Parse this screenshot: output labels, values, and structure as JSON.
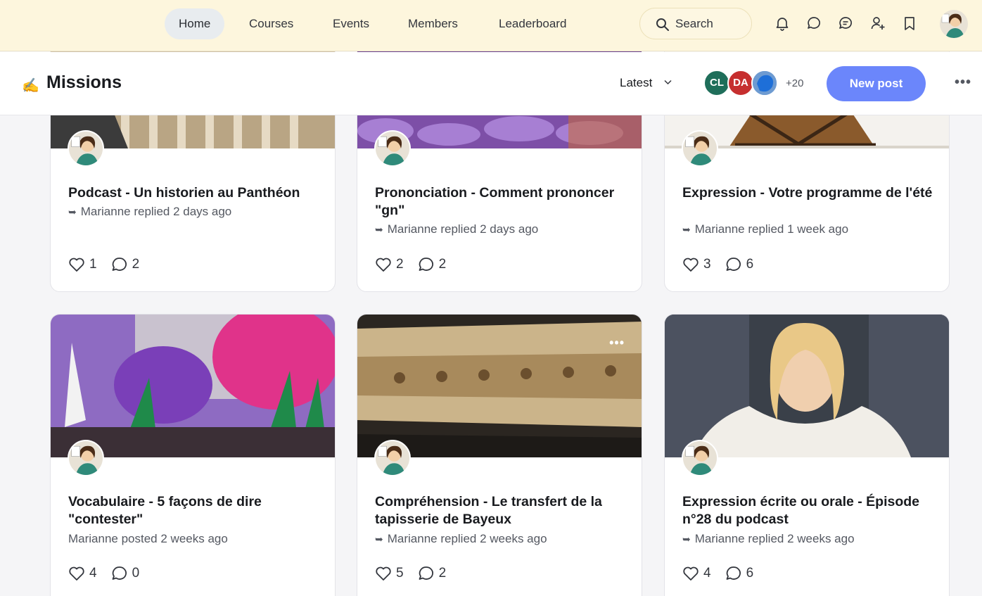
{
  "nav": {
    "items": [
      {
        "label": "Home",
        "active": true
      },
      {
        "label": "Courses"
      },
      {
        "label": "Events"
      },
      {
        "label": "Members"
      },
      {
        "label": "Leaderboard"
      }
    ],
    "search_label": "Search",
    "icons": [
      "bell-icon",
      "chat-icon",
      "messages-icon",
      "add-user-icon",
      "bookmark-icon"
    ]
  },
  "space": {
    "emoji": "✍️",
    "title": "Missions",
    "sort_label": "Latest",
    "members": [
      {
        "initials": "CL",
        "color": "#1f6e5a"
      },
      {
        "initials": "DA",
        "color": "#c62f2f"
      },
      {
        "initials": "",
        "color": "#3b82d6"
      }
    ],
    "member_extra": "+20",
    "new_post_label": "New post",
    "more_label": "•••"
  },
  "posts": [
    {
      "title": "Podcast - Un historien au Panthéon",
      "meta": "Marianne replied 2 days ago",
      "replied": true,
      "likes": "1",
      "comments": "2"
    },
    {
      "title": "Prononciation - Comment prononcer \"gn\"",
      "meta": "Marianne replied 2 days ago",
      "replied": true,
      "likes": "2",
      "comments": "2"
    },
    {
      "title": "Expression - Votre programme de l'été",
      "meta": "Marianne replied 1 week ago",
      "replied": true,
      "likes": "3",
      "comments": "6"
    },
    {
      "title": "Vocabulaire - 5 façons de dire \"contester\"",
      "meta": "Marianne posted 2 weeks ago",
      "replied": false,
      "likes": "4",
      "comments": "0"
    },
    {
      "title": "Compréhension - Le transfert de la tapisserie de Bayeux",
      "meta": "Marianne replied 2 weeks ago",
      "replied": true,
      "likes": "5",
      "comments": "2"
    },
    {
      "title": "Expression écrite ou orale - Épisode n°28 du podcast",
      "meta": "Marianne replied 2 weeks ago",
      "replied": true,
      "likes": "4",
      "comments": "6"
    }
  ],
  "reply_arrow": "➥",
  "card_menu_label": "•••"
}
